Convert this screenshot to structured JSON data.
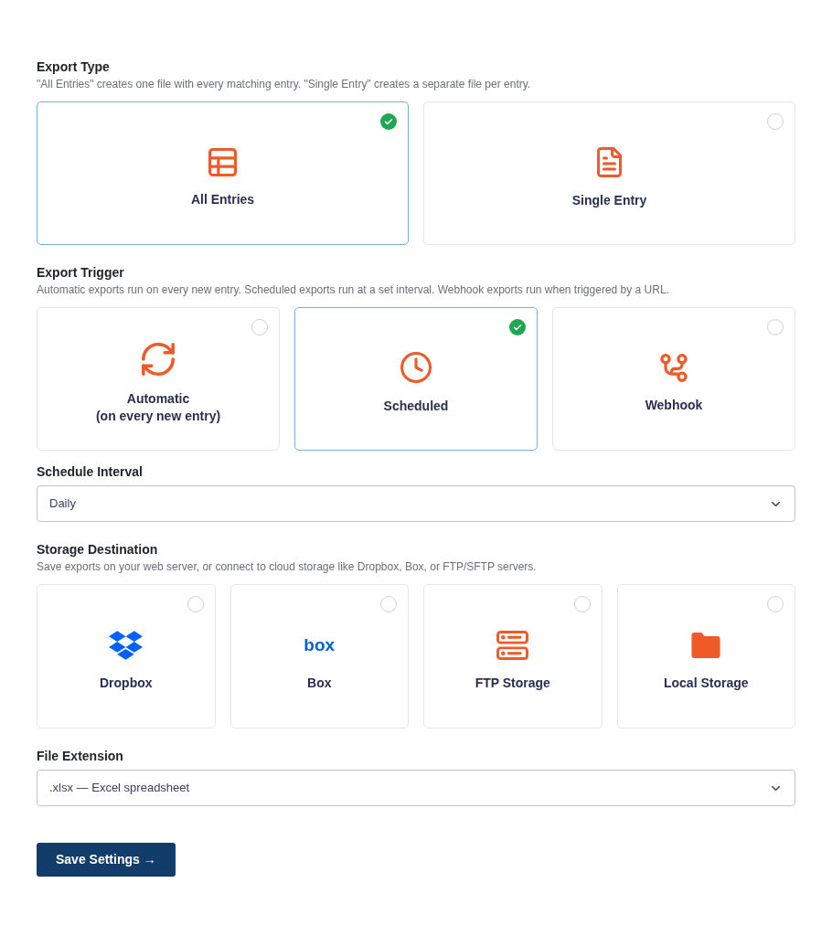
{
  "export_type": {
    "title": "Export Type",
    "description": "\"All Entries\" creates one file with every matching entry. \"Single Entry\" creates a separate file per entry.",
    "options": [
      {
        "label": "All Entries",
        "selected": true
      },
      {
        "label": "Single Entry",
        "selected": false
      }
    ]
  },
  "export_trigger": {
    "title": "Export Trigger",
    "description": "Automatic exports run on every new entry. Scheduled exports run at a set interval. Webhook exports run when triggered by a URL.",
    "options": [
      {
        "label": "Automatic\n(on every new entry)",
        "selected": false
      },
      {
        "label": "Scheduled",
        "selected": true
      },
      {
        "label": "Webhook",
        "selected": false
      }
    ]
  },
  "schedule_interval": {
    "label": "Schedule Interval",
    "value": "Daily"
  },
  "storage_destination": {
    "title": "Storage Destination",
    "description": "Save exports on your web server, or connect to cloud storage like Dropbox, Box, or FTP/SFTP servers.",
    "options": [
      {
        "label": "Dropbox",
        "selected": false
      },
      {
        "label": "Box",
        "logo": "box",
        "selected": false
      },
      {
        "label": "FTP Storage",
        "selected": false
      },
      {
        "label": "Local Storage",
        "selected": false
      }
    ]
  },
  "file_extension": {
    "label": "File Extension",
    "value": ".xlsx — Excel spreadsheet"
  },
  "save_button": {
    "label": "Save Settings →"
  }
}
